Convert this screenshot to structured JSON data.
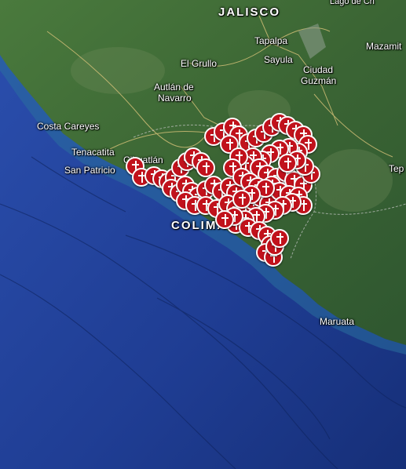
{
  "map": {
    "labels": {
      "jalisco": "JALISCO",
      "tapalpa": "Tapalpa",
      "mazamitla": "Mazamit",
      "sayula": "Sayula",
      "el_grullo": "El Grullo",
      "ciudad_guzman_1": "Ciudad",
      "ciudad_guzman_2": "Guzmán",
      "autlan_1": "Autlán de",
      "autlan_2": "Navarro",
      "costa_careyes": "Costa Careyes",
      "tenacatita": "Tenacatita",
      "cihuatlan": "Cihuatlán",
      "san_patricio": "San Patricio",
      "tep": "Tep",
      "colima": "COLIMA",
      "maruata": "Maruata",
      "top_partial": "Lago de Ch"
    },
    "marker_icon": "cross-icon",
    "marker_color": "#c1121c",
    "land_color": "#3f6b35",
    "ocean_color": "#2344a0"
  }
}
